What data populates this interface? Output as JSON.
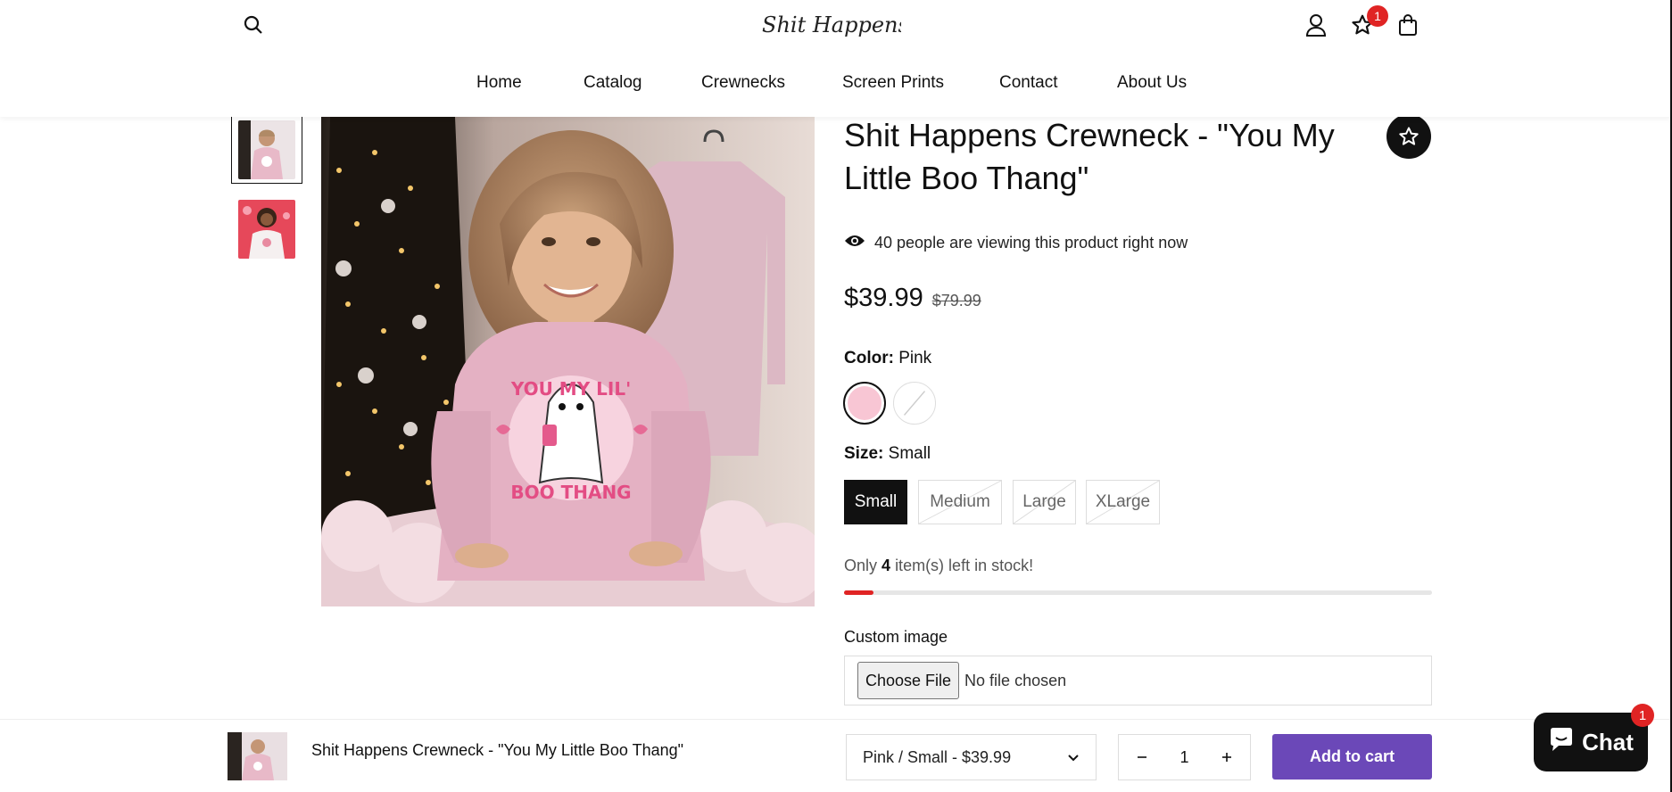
{
  "header": {
    "logo_text": "Shit Happens™",
    "wishlist_count": "1",
    "nav": [
      "Home",
      "Catalog",
      "Crewnecks",
      "Screen Prints",
      "Contact",
      "About Us"
    ]
  },
  "product": {
    "title": "Shit Happens Crewneck - \"You My Little Boo Thang\"",
    "viewing_text": "40 people are viewing this product right now",
    "price": "$39.99",
    "compare_price": "$79.99",
    "color_label": "Color:",
    "color_value": "Pink",
    "size_label": "Size:",
    "size_value": "Small",
    "sizes": [
      "Small",
      "Medium",
      "Large",
      "XLarge"
    ],
    "stock_prefix": "Only",
    "stock_count": "4",
    "stock_suffix": "item(s) left in stock!",
    "stock_fraction": 0.05,
    "custom_image_label": "Custom image",
    "file_button": "Choose File",
    "file_status": "No file chosen",
    "graphic_text_top": "YOU MY LIL'",
    "graphic_text_bottom": "BOO THANG"
  },
  "sticky": {
    "title": "Shit Happens Crewneck - \"You My Little Boo Thang\"",
    "variant": "Pink / Small - $39.99",
    "quantity": "1",
    "add_to_cart": "Add to cart"
  },
  "chat": {
    "label": "Chat",
    "badge": "1"
  },
  "colors": {
    "accent_purple": "#6b48b8",
    "badge_red": "#e02424",
    "swatch_pink": "#f8c6d4"
  }
}
